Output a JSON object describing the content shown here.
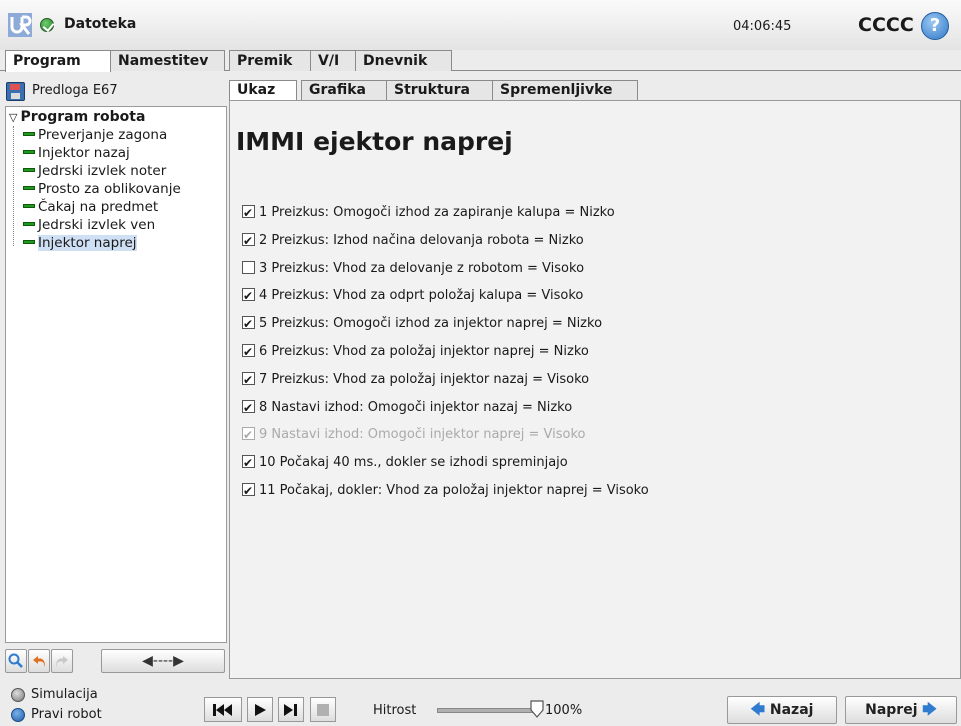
{
  "header": {
    "menu_label": "Datoteka",
    "clock": "04:06:45",
    "robot_name": "CCCC",
    "help_glyph": "?"
  },
  "main_tabs": [
    {
      "label": "Program",
      "active": true
    },
    {
      "label": "Namestitev",
      "active": false
    },
    {
      "label": "Premik",
      "active": false
    },
    {
      "label": "V/I",
      "active": false
    },
    {
      "label": "Dnevnik",
      "active": false
    }
  ],
  "sidebar": {
    "template_label": "Predloga E67",
    "tree_root": "Program robota",
    "nodes": [
      {
        "label": "Preverjanje zagona",
        "selected": false
      },
      {
        "label": "Injektor nazaj",
        "selected": false
      },
      {
        "label": "Jedrski izvlek noter",
        "selected": false
      },
      {
        "label": "Prosto za oblikovanje",
        "selected": false
      },
      {
        "label": "Čakaj na predmet",
        "selected": false
      },
      {
        "label": "Jedrski izvlek ven",
        "selected": false
      },
      {
        "label": "Injektor naprej",
        "selected": true
      }
    ],
    "tools": {
      "search_icon": "search-icon",
      "undo_icon": "undo-icon",
      "redo_icon": "redo-icon",
      "move_arrow": "◀----▶"
    }
  },
  "sub_tabs": [
    {
      "label": "Ukaz",
      "active": true
    },
    {
      "label": "Grafika",
      "active": false
    },
    {
      "label": "Struktura",
      "active": false
    },
    {
      "label": "Spremenljivke",
      "active": false
    }
  ],
  "content": {
    "title": "IMMI ejektor naprej",
    "items": [
      {
        "label": "1 Preizkus: Omogoči izhod za zapiranje kalupa = Nizko",
        "checked": true,
        "enabled": true
      },
      {
        "label": "2 Preizkus: Izhod načina delovanja robota = Nizko",
        "checked": true,
        "enabled": true
      },
      {
        "label": "3 Preizkus: Vhod za delovanje z robotom = Visoko",
        "checked": false,
        "enabled": true
      },
      {
        "label": "4 Preizkus: Vhod za odprt položaj kalupa = Visoko",
        "checked": true,
        "enabled": true
      },
      {
        "label": "5 Preizkus: Omogoči izhod za injektor naprej = Nizko",
        "checked": true,
        "enabled": true
      },
      {
        "label": "6 Preizkus: Vhod za položaj injektor naprej = Nizko",
        "checked": true,
        "enabled": true
      },
      {
        "label": "7 Preizkus: Vhod za položaj injektor nazaj = Visoko",
        "checked": true,
        "enabled": true
      },
      {
        "label": "8 Nastavi izhod: Omogoči injektor nazaj = Nizko",
        "checked": true,
        "enabled": true
      },
      {
        "label": "9 Nastavi izhod: Omogoči injektor naprej = Visoko",
        "checked": true,
        "enabled": false
      },
      {
        "label": "10 Počakaj 40 ms., dokler se izhodi spreminjajo",
        "checked": true,
        "enabled": true
      },
      {
        "label": "11 Počakaj, dokler: Vhod za položaj injektor naprej = Visoko",
        "checked": true,
        "enabled": true
      }
    ]
  },
  "footer": {
    "mode_simulation": "Simulacija",
    "mode_real": "Pravi robot",
    "speed_label": "Hitrost",
    "speed_value": "100%",
    "speed_fraction": 1.0,
    "back_label": "Nazaj",
    "next_label": "Naprej",
    "back_arrow": "🡄",
    "next_arrow": "🡆"
  },
  "colors": {
    "accent_blue": "#2f7bd0",
    "tree_node_green": "#1f9a1f",
    "selection": "#cfe0f5"
  }
}
